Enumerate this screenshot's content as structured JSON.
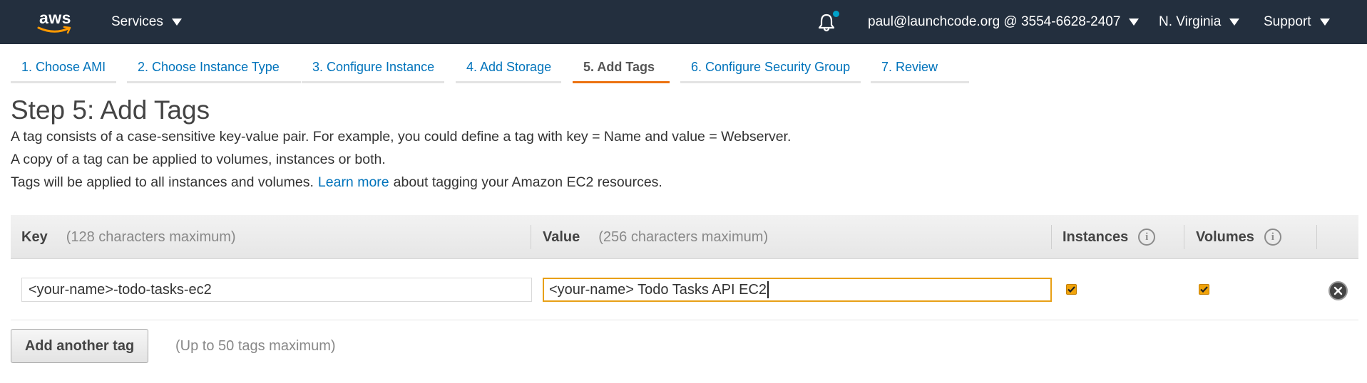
{
  "header": {
    "logo_text": "aws",
    "services_label": "Services",
    "account_label": "paul@launchcode.org @ 3554-6628-2407",
    "region_label": "N. Virginia",
    "support_label": "Support"
  },
  "wizard": {
    "tabs": [
      {
        "label": "1. Choose AMI"
      },
      {
        "label": "2. Choose Instance Type"
      },
      {
        "label": "3. Configure Instance"
      },
      {
        "label": "4. Add Storage"
      },
      {
        "label": "5. Add Tags"
      },
      {
        "label": "6. Configure Security Group"
      },
      {
        "label": "7. Review"
      }
    ],
    "active_tab": "5. Add Tags"
  },
  "page": {
    "title": "Step 5: Add Tags",
    "desc_line1": "A tag consists of a case-sensitive key-value pair. For example, you could define a tag with key = Name and value = Webserver.",
    "desc_line2": "A copy of a tag can be applied to volumes, instances or both.",
    "desc_line3_pre": "Tags will be applied to all instances and volumes.",
    "learn_more": "Learn more",
    "desc_line3_post": "about tagging your Amazon EC2 resources."
  },
  "table": {
    "key_header": "Key",
    "key_hint": "(128 characters maximum)",
    "value_header": "Value",
    "value_hint": "(256 characters maximum)",
    "instances_header": "Instances",
    "volumes_header": "Volumes",
    "info_glyph": "i",
    "rows": [
      {
        "key": "<your-name>-todo-tasks-ec2",
        "value": "<your-name> Todo Tasks API EC2",
        "instances_checked": true,
        "volumes_checked": true
      }
    ]
  },
  "footer": {
    "add_button": "Add another tag",
    "limit_hint": "(Up to 50 tags maximum)"
  },
  "colors": {
    "nav_bg": "#232f3e",
    "link": "#0073bb",
    "accent": "#ec7211",
    "checkbox": "#f0a30a",
    "notification_dot": "#00a1c9"
  }
}
